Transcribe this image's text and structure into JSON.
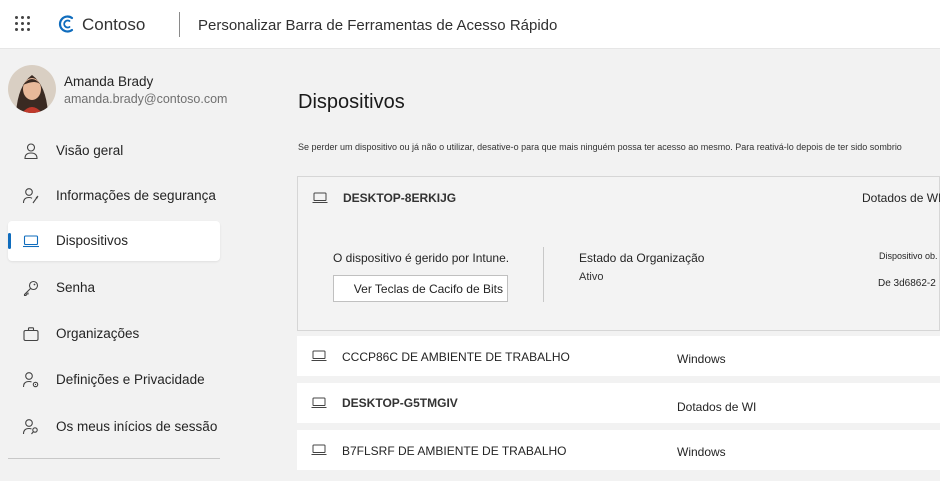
{
  "header": {
    "brand": "Contoso",
    "title": "Personalizar Barra de Ferramentas de Acesso Rápido"
  },
  "user": {
    "name": "Amanda Brady",
    "email": "amanda.brady@contoso.com"
  },
  "sidebar": {
    "items": [
      {
        "label": "Visão geral",
        "icon": "person-icon",
        "active": false
      },
      {
        "label": "Informações de segurança",
        "icon": "person-key-icon",
        "active": false
      },
      {
        "label": "Dispositivos",
        "icon": "laptop-icon",
        "active": true
      },
      {
        "label": "Senha",
        "icon": "key-icon",
        "active": false
      },
      {
        "label": "Organizações",
        "icon": "briefcase-icon",
        "active": false
      },
      {
        "label": "Definições e Privacidade",
        "icon": "person-settings-icon",
        "active": false
      },
      {
        "label": "Os meus inícios de sessão",
        "icon": "person-lock-icon",
        "active": false
      }
    ]
  },
  "main": {
    "title": "Dispositivos",
    "description": "Se perder um dispositivo ou já não o utilizar, desative-o para que mais ninguém possa ter acesso ao mesmo. Para reativá-lo depois de ter sido sombrio"
  },
  "devices": [
    {
      "name": "DESKTOP-8ERKIJG",
      "type": "Dotados de WI",
      "expanded": true,
      "details": {
        "managed_label": "O dispositivo é gerido por Intune.",
        "bitlocker_button": "Ver Teclas de Cacifo de Bits",
        "org_state_label": "Estado da Organização",
        "org_state_value": "Ativo",
        "device_id_label": "Dispositivo ob.",
        "device_id_value": "De 3d6862-2"
      }
    },
    {
      "name": "CCCP86C DE AMBIENTE DE TRABALHO",
      "type": "Windows",
      "expanded": false
    },
    {
      "name": "DESKTOP-G5TMGIV",
      "type": "Dotados de WI",
      "expanded": false
    },
    {
      "name": "B7FLSRF DE AMBIENTE DE TRABALHO",
      "type": "Windows",
      "expanded": false
    }
  ],
  "colors": {
    "accent": "#0f6cbd",
    "page_background": "#f2f2f2",
    "card_background": "#ffffff"
  }
}
